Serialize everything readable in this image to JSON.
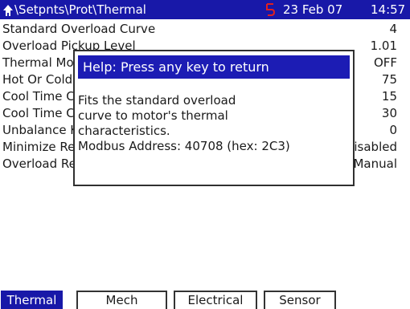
{
  "header": {
    "path": "\\Setpnts\\Prot\\Thermal",
    "date": "23 Feb 07",
    "time": "14:57",
    "home_icon": "home-icon",
    "alarm_icon": "alarm-indicator-icon"
  },
  "rows": [
    {
      "label": "Standard Overload Curve",
      "value": "4"
    },
    {
      "label": "Overload Pickup Level",
      "value": "1.01"
    },
    {
      "label": "Thermal Model Biasing",
      "value": "OFF"
    },
    {
      "label": "Hot Or Cold Safe Stall Ratio",
      "value": "75"
    },
    {
      "label": "Cool Time Constant Running",
      "value": "15"
    },
    {
      "label": "Cool Time Constant Stopped",
      "value": "30"
    },
    {
      "label": "Unbalance K Factor",
      "value": "0"
    },
    {
      "label": "Minimize Reset Time",
      "value": "Disabled"
    },
    {
      "label": "Overload Reset Mode",
      "value": "Manual"
    }
  ],
  "help_dialog": {
    "title": "Help: Press any key to return",
    "lines": [
      "Fits the standard overload",
      "curve to motor's thermal",
      "characteristics.",
      "Modbus Address: 40708 (hex: 2C3)"
    ]
  },
  "tabs": [
    {
      "label": "Thermal",
      "active": true
    },
    {
      "label": "Mech",
      "active": false
    },
    {
      "label": "Electrical",
      "active": false
    },
    {
      "label": "Sensor",
      "active": false
    }
  ],
  "colors": {
    "header_bg": "#1818a8",
    "dialog_title_bg": "#1c1cb4",
    "alarm": "#e02020"
  }
}
